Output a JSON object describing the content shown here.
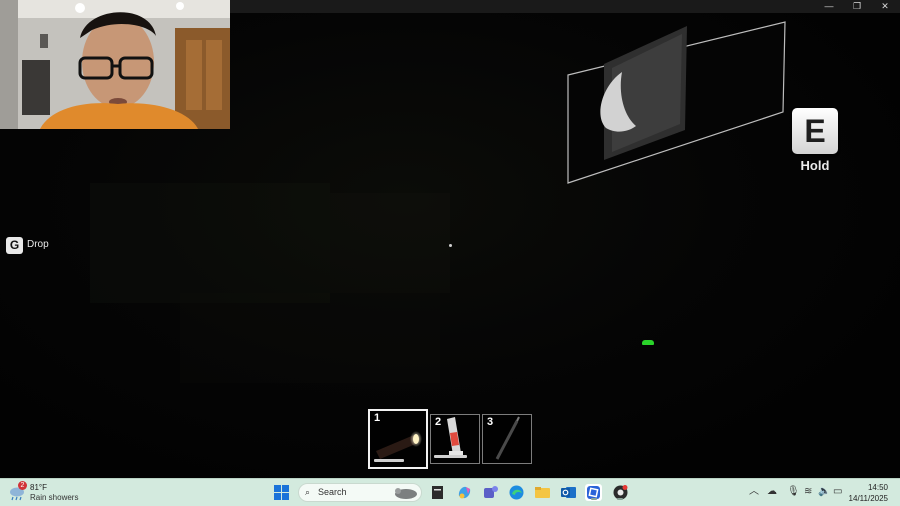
{
  "window": {
    "controls": {
      "minimize": "—",
      "restore": "❐",
      "close": "✕"
    }
  },
  "hud": {
    "drop_key": "G",
    "drop_label": "Drop",
    "interact_key": "E",
    "interact_label": "Hold"
  },
  "hotbar": {
    "slots": [
      {
        "number": "1",
        "item_icon": "flashlight-icon",
        "selected": true,
        "bar_level": 0.55
      },
      {
        "number": "2",
        "item_icon": "glow-stick-icon",
        "selected": false,
        "bar_level": 0.75
      },
      {
        "number": "3",
        "item_icon": "crowbar-icon",
        "selected": false
      }
    ]
  },
  "taskbar": {
    "weather": {
      "badge": "2",
      "temp": "81°F",
      "desc": "Rain showers"
    },
    "search_placeholder": "Search",
    "clock": {
      "time": "14:50",
      "date": "14/11/2025"
    },
    "pinned_icons": [
      "windows-start-icon",
      "file-icon",
      "copilot-icon",
      "teams-icon",
      "edge-icon",
      "file-explorer-icon",
      "outlook-icon",
      "roblox-studio-icon",
      "chrome-icon"
    ],
    "tray_icons": [
      "chevron-up-icon",
      "onedrive-icon",
      "microphone-icon",
      "wifi-icon",
      "speaker-icon",
      "battery-icon"
    ],
    "colors": {
      "bar": "#d3eade"
    }
  }
}
